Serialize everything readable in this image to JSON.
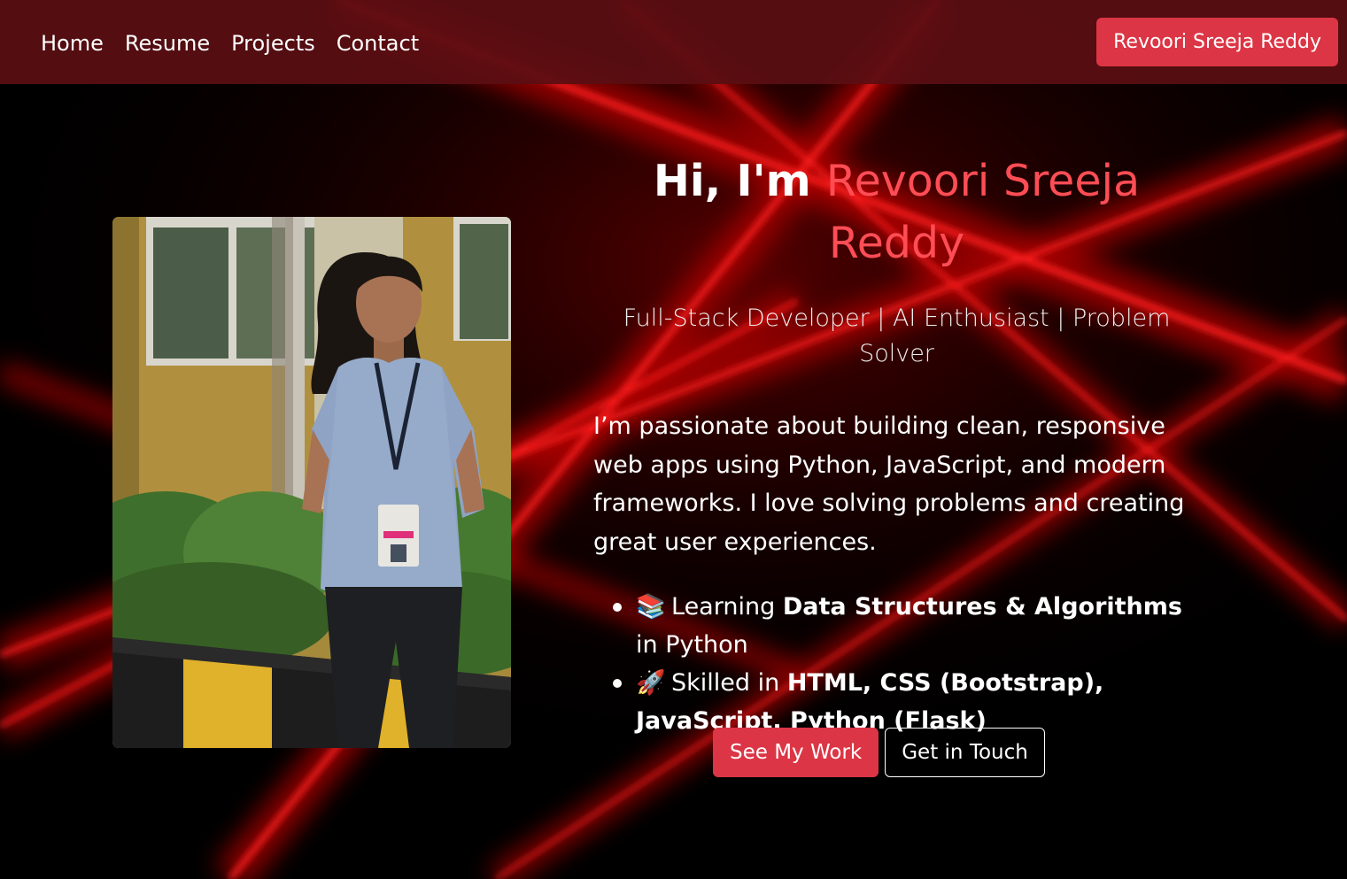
{
  "nav": {
    "links": [
      "Home",
      "Resume",
      "Projects",
      "Contact"
    ],
    "brand_button": "Revoori Sreeja Reddy"
  },
  "hero": {
    "greeting": "Hi, I'm",
    "name": "Revoori Sreeja Reddy",
    "subtitle": "Full-Stack Developer | AI Enthusiast | Problem Solver",
    "about": "I’m passionate about building clean, responsive web apps using Python, JavaScript, and modern frameworks. I love solving problems and creating great user experiences.",
    "skills": [
      {
        "emoji": "📚",
        "prefix": "Learning ",
        "bold": "Data Structures & Algorithms",
        "suffix": " in Python"
      },
      {
        "emoji": "🚀",
        "prefix": "Skilled in ",
        "bold": "HTML, CSS (Bootstrap), JavaScript, Python (Flask)",
        "suffix": ""
      }
    ],
    "primary_button": "See My Work",
    "secondary_button": "Get in Touch"
  },
  "colors": {
    "accent": "#dc3545",
    "name_highlight": "#ff4d55",
    "navbar": "#5a0e12",
    "background": "#000000"
  },
  "icons": [
    "books-icon",
    "rocket-icon"
  ]
}
